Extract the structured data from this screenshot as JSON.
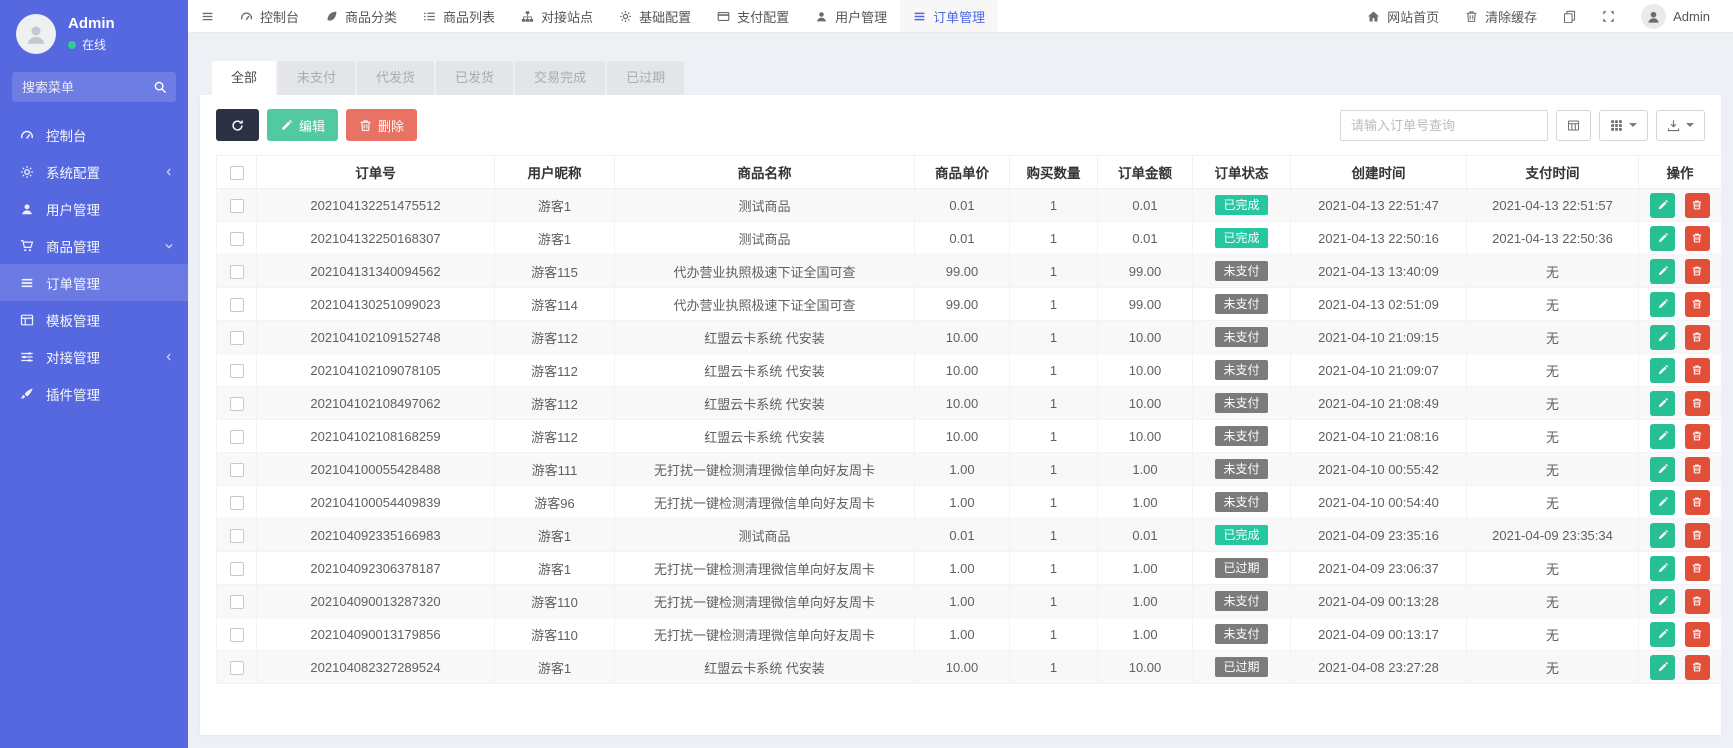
{
  "sidebar": {
    "user_name": "Admin",
    "user_status": "在线",
    "search_placeholder": "搜索菜单",
    "menu": [
      {
        "label": "控制台",
        "icon": "dashboard-icon"
      },
      {
        "label": "系统配置",
        "icon": "gear-icon",
        "chevron": "left"
      },
      {
        "label": "用户管理",
        "icon": "user-icon"
      },
      {
        "label": "商品管理",
        "icon": "cart-icon",
        "chevron": "down"
      },
      {
        "label": "订单管理",
        "icon": "order-list-icon",
        "active": true
      },
      {
        "label": "模板管理",
        "icon": "template-icon"
      },
      {
        "label": "对接管理",
        "icon": "sliders-icon",
        "chevron": "left"
      },
      {
        "label": "插件管理",
        "icon": "brush-icon"
      }
    ]
  },
  "navbar": {
    "items": [
      {
        "label": "控制台"
      },
      {
        "label": "商品分类"
      },
      {
        "label": "商品列表"
      },
      {
        "label": "对接站点"
      },
      {
        "label": "基础配置"
      },
      {
        "label": "支付配置"
      },
      {
        "label": "用户管理"
      },
      {
        "label": "订单管理",
        "active": true
      }
    ],
    "home_label": "网站首页",
    "clear_cache_label": "清除缓存",
    "user_name": "Admin"
  },
  "tabs": [
    {
      "label": "全部",
      "active": true
    },
    {
      "label": "未支付"
    },
    {
      "label": "代发货"
    },
    {
      "label": "已发货"
    },
    {
      "label": "交易完成"
    },
    {
      "label": "已过期"
    }
  ],
  "toolbar": {
    "edit_label": "编辑",
    "delete_label": "删除",
    "search_placeholder": "请输入订单号查询"
  },
  "table": {
    "headers": [
      "订单号",
      "用户昵称",
      "商品名称",
      "商品单价",
      "购买数量",
      "订单金额",
      "订单状态",
      "创建时间",
      "支付时间",
      "操作"
    ],
    "rows": [
      {
        "order_no": "202104132251475512",
        "nickname": "游客1",
        "product": "测试商品",
        "price": "0.01",
        "qty": "1",
        "amount": "0.01",
        "status": "已完成",
        "status_state": "completed",
        "created": "2021-04-13 22:51:47",
        "paid": "2021-04-13 22:51:57"
      },
      {
        "order_no": "202104132250168307",
        "nickname": "游客1",
        "product": "测试商品",
        "price": "0.01",
        "qty": "1",
        "amount": "0.01",
        "status": "已完成",
        "status_state": "completed",
        "created": "2021-04-13 22:50:16",
        "paid": "2021-04-13 22:50:36"
      },
      {
        "order_no": "202104131340094562",
        "nickname": "游客115",
        "product": "代办营业执照极速下证全国可查",
        "price": "99.00",
        "qty": "1",
        "amount": "99.00",
        "status": "未支付",
        "status_state": "unpaid",
        "created": "2021-04-13 13:40:09",
        "paid": "无"
      },
      {
        "order_no": "202104130251099023",
        "nickname": "游客114",
        "product": "代办营业执照极速下证全国可查",
        "price": "99.00",
        "qty": "1",
        "amount": "99.00",
        "status": "未支付",
        "status_state": "unpaid",
        "created": "2021-04-13 02:51:09",
        "paid": "无"
      },
      {
        "order_no": "202104102109152748",
        "nickname": "游客112",
        "product": "红盟云卡系统 代安装",
        "price": "10.00",
        "qty": "1",
        "amount": "10.00",
        "status": "未支付",
        "status_state": "unpaid",
        "created": "2021-04-10 21:09:15",
        "paid": "无"
      },
      {
        "order_no": "202104102109078105",
        "nickname": "游客112",
        "product": "红盟云卡系统 代安装",
        "price": "10.00",
        "qty": "1",
        "amount": "10.00",
        "status": "未支付",
        "status_state": "unpaid",
        "created": "2021-04-10 21:09:07",
        "paid": "无"
      },
      {
        "order_no": "202104102108497062",
        "nickname": "游客112",
        "product": "红盟云卡系统 代安装",
        "price": "10.00",
        "qty": "1",
        "amount": "10.00",
        "status": "未支付",
        "status_state": "unpaid",
        "created": "2021-04-10 21:08:49",
        "paid": "无"
      },
      {
        "order_no": "202104102108168259",
        "nickname": "游客112",
        "product": "红盟云卡系统 代安装",
        "price": "10.00",
        "qty": "1",
        "amount": "10.00",
        "status": "未支付",
        "status_state": "unpaid",
        "created": "2021-04-10 21:08:16",
        "paid": "无"
      },
      {
        "order_no": "202104100055428488",
        "nickname": "游客111",
        "product": "无打扰一键检测清理微信单向好友周卡",
        "price": "1.00",
        "qty": "1",
        "amount": "1.00",
        "status": "未支付",
        "status_state": "unpaid",
        "created": "2021-04-10 00:55:42",
        "paid": "无"
      },
      {
        "order_no": "202104100054409839",
        "nickname": "游客96",
        "product": "无打扰一键检测清理微信单向好友周卡",
        "price": "1.00",
        "qty": "1",
        "amount": "1.00",
        "status": "未支付",
        "status_state": "unpaid",
        "created": "2021-04-10 00:54:40",
        "paid": "无"
      },
      {
        "order_no": "202104092335166983",
        "nickname": "游客1",
        "product": "测试商品",
        "price": "0.01",
        "qty": "1",
        "amount": "0.01",
        "status": "已完成",
        "status_state": "completed",
        "created": "2021-04-09 23:35:16",
        "paid": "2021-04-09 23:35:34"
      },
      {
        "order_no": "202104092306378187",
        "nickname": "游客1",
        "product": "无打扰一键检测清理微信单向好友周卡",
        "price": "1.00",
        "qty": "1",
        "amount": "1.00",
        "status": "已过期",
        "status_state": "expired",
        "created": "2021-04-09 23:06:37",
        "paid": "无"
      },
      {
        "order_no": "202104090013287320",
        "nickname": "游客110",
        "product": "无打扰一键检测清理微信单向好友周卡",
        "price": "1.00",
        "qty": "1",
        "amount": "1.00",
        "status": "未支付",
        "status_state": "unpaid",
        "created": "2021-04-09 00:13:28",
        "paid": "无"
      },
      {
        "order_no": "202104090013179856",
        "nickname": "游客110",
        "product": "无打扰一键检测清理微信单向好友周卡",
        "price": "1.00",
        "qty": "1",
        "amount": "1.00",
        "status": "未支付",
        "status_state": "unpaid",
        "created": "2021-04-09 00:13:17",
        "paid": "无"
      },
      {
        "order_no": "202104082327289524",
        "nickname": "游客1",
        "product": "红盟云卡系统 代安装",
        "price": "10.00",
        "qty": "1",
        "amount": "10.00",
        "status": "已过期",
        "status_state": "expired",
        "created": "2021-04-08 23:27:28",
        "paid": "无"
      }
    ]
  },
  "colors": {
    "primary": "#5568df",
    "success_badge": "#24c7a0",
    "muted_badge": "#7b7b7b",
    "edit_button": "#53c9a2",
    "delete_button": "#e87263",
    "row_edit": "#27bf93",
    "row_delete": "#e14f38"
  }
}
